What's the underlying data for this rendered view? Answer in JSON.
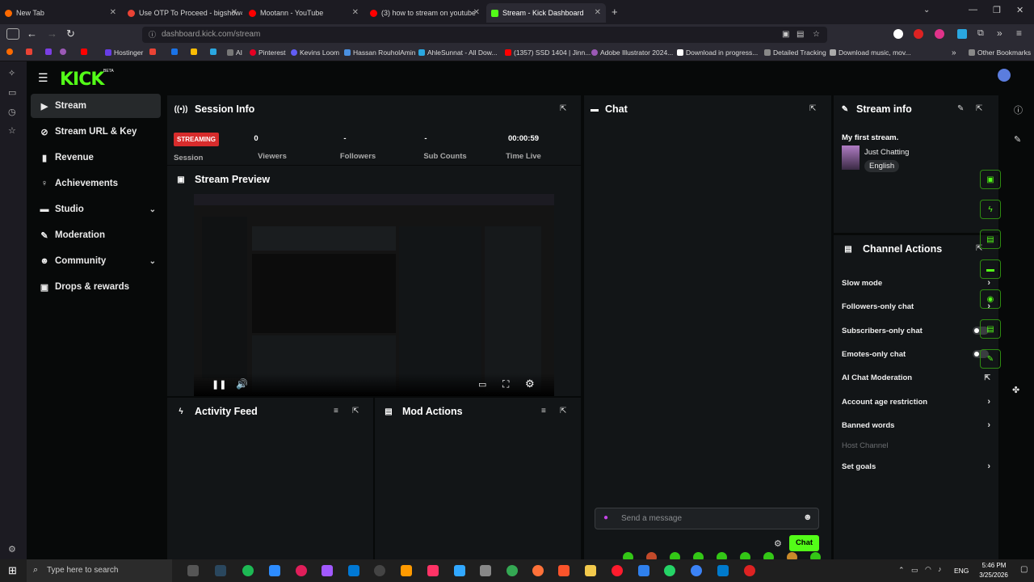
{
  "browser": {
    "tabs": [
      {
        "title": "New Tab",
        "color": "#ff6a00"
      },
      {
        "title": "Use OTP To Proceed - bigshow4",
        "color": "#ea4335"
      },
      {
        "title": "Mootann - YouTube",
        "color": "#ff0000"
      },
      {
        "title": "(3) how to stream on youtube",
        "color": "#ff0000"
      },
      {
        "title": "Stream - Kick Dashboard",
        "color": "#53fc18"
      }
    ],
    "url": "dashboard.kick.com/stream",
    "bookmarks": [
      "Hostinger",
      "AI",
      "Pinterest",
      "Kevins Loom",
      "Hassan RouholAmin",
      "AhleSunnat - All Dow...",
      "(1357) SSD 1404 | Jinn...",
      "Adobe Illustrator 2024...",
      "Download in progress...",
      "Detailed Tracking",
      "Download music, mov..."
    ],
    "other_bookmarks": "Other Bookmarks"
  },
  "app": {
    "logo": "KICK",
    "beta": "BETA",
    "nav": [
      {
        "label": "Stream",
        "icon": "stream-icon",
        "glyph": "▶"
      },
      {
        "label": "Stream URL & Key",
        "icon": "link-icon",
        "glyph": "⊘"
      },
      {
        "label": "Revenue",
        "icon": "revenue-icon",
        "glyph": "▮"
      },
      {
        "label": "Achievements",
        "icon": "trophy-icon",
        "glyph": "♀"
      },
      {
        "label": "Studio",
        "icon": "studio-icon",
        "glyph": "▬"
      },
      {
        "label": "Moderation",
        "icon": "wrench-icon",
        "glyph": "✎"
      },
      {
        "label": "Community",
        "icon": "community-icon",
        "glyph": "☻"
      },
      {
        "label": "Drops & rewards",
        "icon": "gift-icon",
        "glyph": "▣"
      }
    ],
    "session": {
      "title": "Session Info",
      "badge": "STREAMING",
      "session_label": "Session",
      "stats": [
        {
          "value": "0",
          "label": "Viewers"
        },
        {
          "value": "-",
          "label": "Followers"
        },
        {
          "value": "-",
          "label": "Sub Counts"
        },
        {
          "value": "00:00:59",
          "label": "Time Live"
        }
      ]
    },
    "preview": {
      "title": "Stream Preview"
    },
    "activity": {
      "title": "Activity Feed"
    },
    "mod": {
      "title": "Mod Actions"
    },
    "chat": {
      "title": "Chat",
      "placeholder": "Send a message",
      "send_label": "Chat"
    },
    "stream_info": {
      "title": "Stream info",
      "stream_title": "My first stream.",
      "category": "Just Chatting",
      "language": "English"
    },
    "channel_actions": {
      "title": "Channel Actions",
      "items": [
        {
          "label": "Slow mode",
          "control": "chevron"
        },
        {
          "label": "Followers-only chat",
          "control": "chevron"
        },
        {
          "label": "Subscribers-only chat",
          "control": "toggle"
        },
        {
          "label": "Emotes-only chat",
          "control": "toggle"
        },
        {
          "label": "AI Chat Moderation",
          "control": "external"
        },
        {
          "label": "Account age restriction",
          "control": "chevron"
        },
        {
          "label": "Banned words",
          "control": "chevron"
        },
        {
          "label": "Host Channel",
          "control": "none"
        },
        {
          "label": "Set goals",
          "control": "chevron"
        }
      ]
    }
  },
  "taskbar": {
    "search_placeholder": "Type here to search",
    "language": "ENG",
    "time": "5:46 PM",
    "date": "3/25/2026"
  }
}
